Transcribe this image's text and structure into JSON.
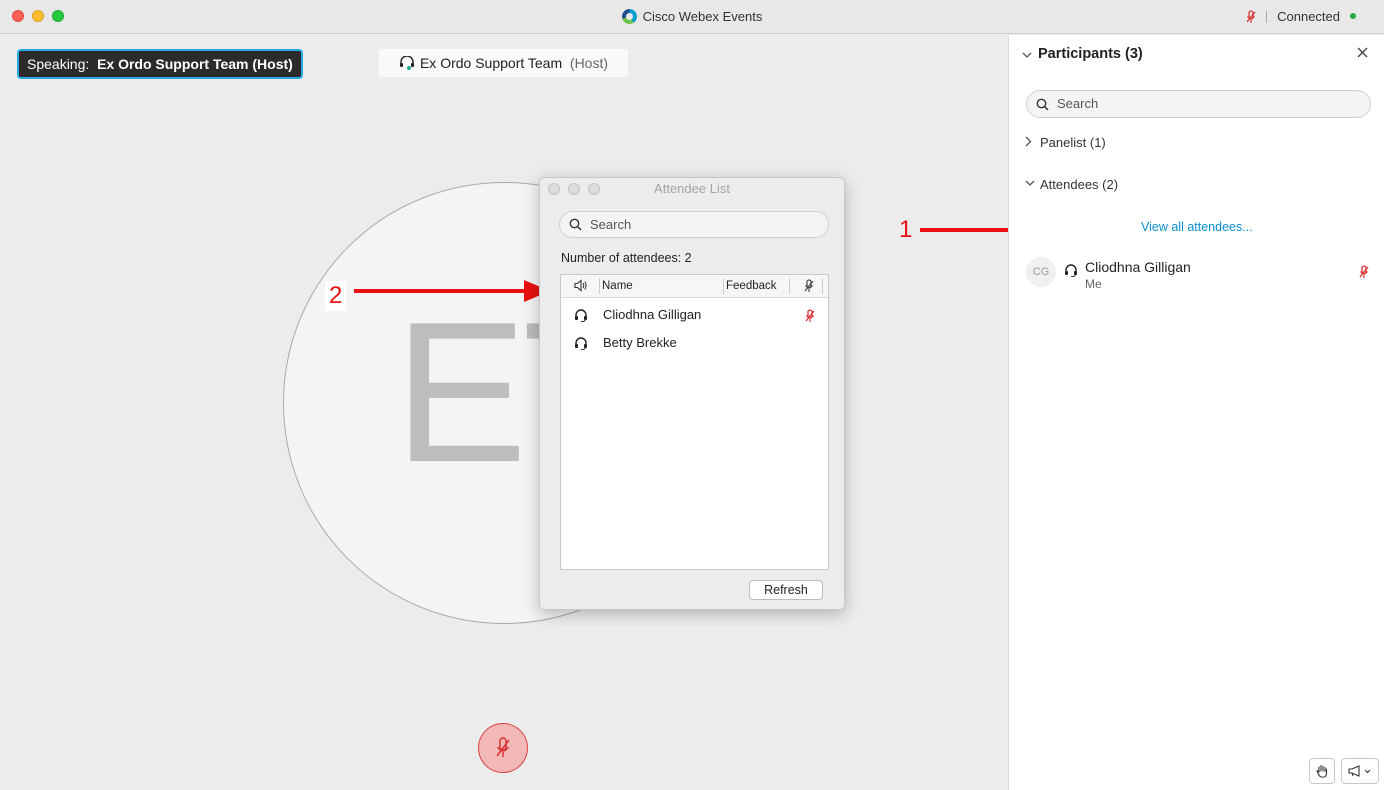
{
  "window": {
    "title": "Cisco Webex Events",
    "connection_status": "Connected"
  },
  "stage": {
    "speaking_prefix": "Speaking:",
    "speaking_name": "Ex Ordo Support Team (Host)",
    "host_name": "Ex Ordo Support Team",
    "host_role": "(Host)",
    "avatar_initials": "ET"
  },
  "annotations": {
    "arrow_1_label": "1",
    "arrow_2_label": "2"
  },
  "attendee_dialog": {
    "title": "Attendee List",
    "search_placeholder": "Search",
    "count_text": "Number of attendees: 2",
    "columns": {
      "name": "Name",
      "feedback": "Feedback"
    },
    "rows": [
      {
        "name": "Cliodhna Gilligan",
        "muted": true
      },
      {
        "name": "Betty Brekke",
        "muted": false
      }
    ],
    "refresh_label": "Refresh"
  },
  "participants_panel": {
    "title": "Participants (3)",
    "search_placeholder": "Search",
    "panelist_label": "Panelist (1)",
    "attendees_label": "Attendees (2)",
    "view_all_label": "View all attendees...",
    "me": {
      "initials": "CG",
      "name": "Cliodhna Gilligan",
      "sub": "Me"
    }
  },
  "colors": {
    "accent_blue": "#27a9e1",
    "link_blue": "#0b8fcf",
    "mute_red": "#d84040",
    "annotation_red": "#e81010"
  }
}
